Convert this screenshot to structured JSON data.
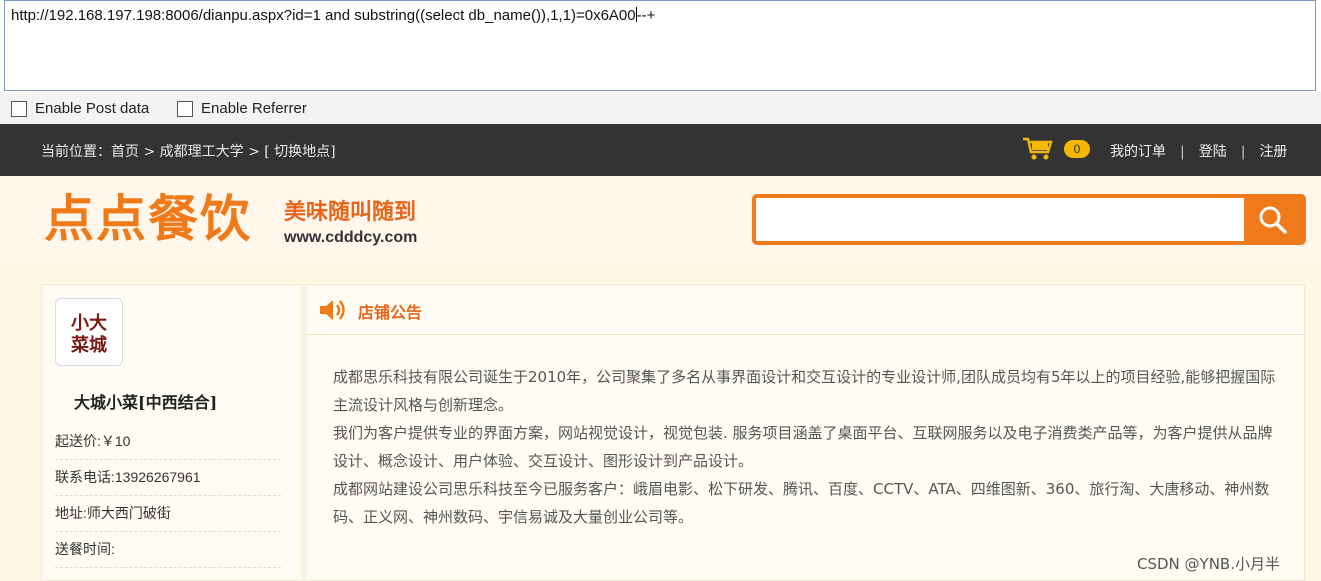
{
  "hackbar": {
    "url": "http://192.168.197.198:8006/dianpu.aspx?id=1 and substring((select db_name()),1,1)=0x6A00",
    "url_tail": "--+",
    "enable_post_label": "Enable Post data",
    "enable_referrer_label": "Enable Referrer"
  },
  "topnav": {
    "breadcrumb": "当前位置：首页 > 成都理工大学 > [ 切换地点]",
    "cart_count": "0",
    "my_orders": "我的订单",
    "sep": "|",
    "login": "登陆",
    "register": "注册"
  },
  "header": {
    "logo_text": "点点餐饮",
    "slogan": "美味随叫随到",
    "site_url": "www.cdddcy.com",
    "search_placeholder": ""
  },
  "shop": {
    "logo_text": "小大菜城",
    "name": "大城小菜[中西结合]",
    "min_price": "起送价:￥10",
    "phone": "联系电话:13926267961",
    "address": "地址:师大西门破街",
    "delivery_time": "送餐时间:"
  },
  "notice": {
    "title": "店铺公告",
    "paragraphs": [
      "成都思乐科技有限公司诞生于2010年，公司聚集了多名从事界面设计和交互设计的专业设计师,团队成员均有5年以上的项目经验,能够把握国际主流设计风格与创新理念。",
      "我们为客户提供专业的界面方案，网站视觉设计，视觉包装. 服务项目涵盖了桌面平台、互联网服务以及电子消费类产品等，为客户提供从品牌设计、概念设计、用户体验、交互设计、图形设计到产品设计。",
      "成都网站建设公司思乐科技至今已服务客户：峨眉电影、松下研发、腾讯、百度、CCTV、ATA、四维图新、360、旅行淘、大唐移动、神州数码、正义网、神州数码、宇信易诚及大量创业公司等。"
    ]
  },
  "watermark": "CSDN @YNB.小月半",
  "colors": {
    "accent": "#f07a1a",
    "nav_bg": "#333333",
    "badge": "#f5b800"
  }
}
